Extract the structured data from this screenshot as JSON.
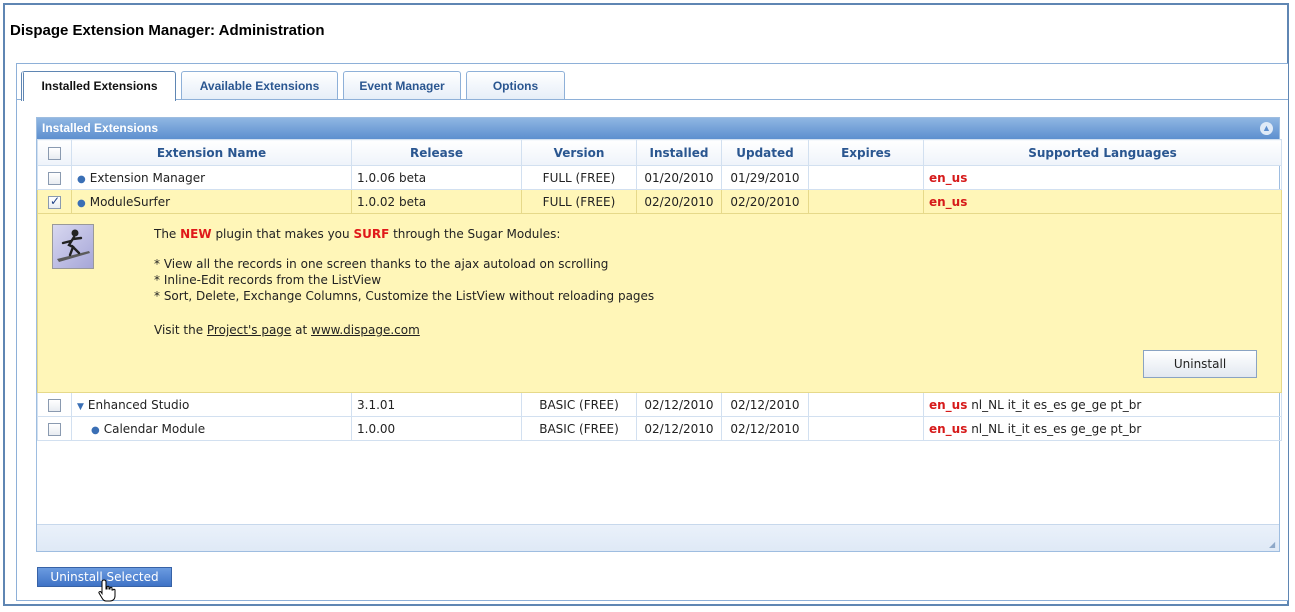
{
  "title": "Dispage Extension Manager: Administration",
  "tabs": [
    {
      "label": "Installed Extensions"
    },
    {
      "label": "Available Extensions"
    },
    {
      "label": "Event Manager"
    },
    {
      "label": "Options"
    }
  ],
  "grid": {
    "title": "Installed Extensions",
    "columns": [
      "Extension Name",
      "Release",
      "Version",
      "Installed",
      "Updated",
      "Expires",
      "Supported Languages"
    ],
    "rows": [
      {
        "name": "Extension Manager",
        "release": "1.0.06 beta",
        "version": "FULL (FREE)",
        "installed": "01/20/2010",
        "updated": "01/29/2010",
        "expires": "",
        "lang_main": "en_us",
        "lang_other": ""
      },
      {
        "name": "ModuleSurfer",
        "release": "1.0.02 beta",
        "version": "FULL (FREE)",
        "installed": "02/20/2010",
        "updated": "02/20/2010",
        "expires": "",
        "lang_main": "en_us",
        "lang_other": ""
      },
      {
        "name": "Enhanced Studio",
        "release": "3.1.01",
        "version": "BASIC (FREE)",
        "installed": "02/12/2010",
        "updated": "02/12/2010",
        "expires": "",
        "lang_main": "en_us",
        "lang_other": "nl_NL it_it es_es ge_ge pt_br"
      },
      {
        "name": "Calendar Module",
        "release": "1.0.00",
        "version": "BASIC (FREE)",
        "installed": "02/12/2010",
        "updated": "02/12/2010",
        "expires": "",
        "lang_main": "en_us",
        "lang_other": "nl_NL it_it es_es ge_ge pt_br"
      }
    ],
    "detail": {
      "intro_1": "The ",
      "intro_new": "NEW",
      "intro_2": " plugin that makes you ",
      "intro_surf": "SURF",
      "intro_3": " through the Sugar Modules:",
      "bullet_1": "* View all the records in one screen thanks to the ajax autoload on scrolling",
      "bullet_2": "* Inline-Edit records from the ListView",
      "bullet_3": "* Sort, Delete, Exchange Columns, Customize the ListView without reloading pages",
      "visit_1": "Visit the ",
      "visit_link": "Project's page",
      "visit_2": " at ",
      "visit_site": "www.dispage.com",
      "uninstall_label": "Uninstall"
    }
  },
  "uninstall_selected_label": "Uninstall Selected",
  "colors": {
    "accent": "#5d8fcf",
    "selected_row": "#fff6b8",
    "lang_main": "#d61a1a"
  }
}
